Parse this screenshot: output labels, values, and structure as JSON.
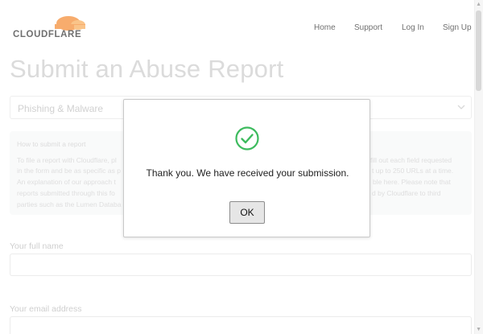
{
  "brand": {
    "name": "CLOUDFLARE",
    "logo_color": "#f38020"
  },
  "nav": {
    "home": "Home",
    "support": "Support",
    "login": "Log In",
    "signup": "Sign Up"
  },
  "page": {
    "title": "Submit an Abuse Report",
    "report_type": "Phishing & Malware",
    "info": {
      "title": "How to submit a report",
      "lines_left": [
        "To file a report with Cloudflare, pl",
        "in the form and be as specific as p",
        "An explanation of our approach t",
        "reports submitted through this fo",
        "parties such as the Lumen Databa"
      ],
      "lines_right": [
        "fill out each field requested",
        "t up to 250 URLs at a time.",
        "ble here. Please note that",
        "d by Cloudflare to third",
        ""
      ]
    },
    "fields": {
      "full_name_label": "Your full name",
      "email_label": "Your email address"
    }
  },
  "dialog": {
    "message": "Thank you. We have received your submission.",
    "ok_label": "OK",
    "icon": "check-circle-icon",
    "icon_color": "#3dbb5e"
  }
}
